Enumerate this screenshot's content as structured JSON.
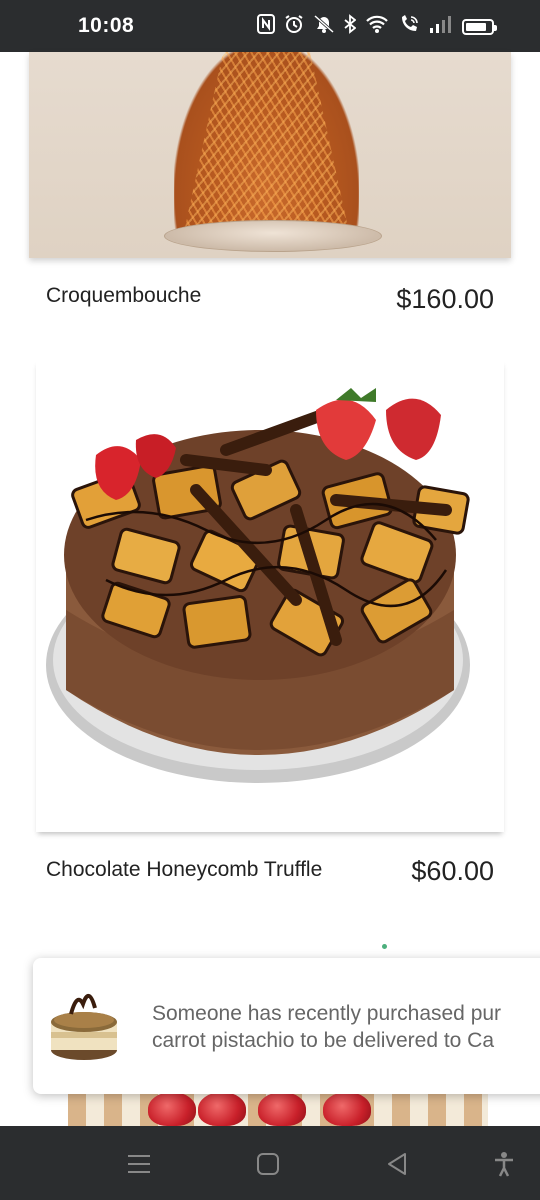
{
  "status_bar": {
    "time": "10:08",
    "icons": [
      "nfc-icon",
      "alarm-icon",
      "mute-icon",
      "bluetooth-icon",
      "wifi-icon",
      "wifi-calling-icon",
      "signal-icon",
      "battery-icon"
    ]
  },
  "products": [
    {
      "name": "Croquembouche",
      "price": "$160.00"
    },
    {
      "name": "Chocolate Honeycomb Truffle",
      "price": "$60.00"
    }
  ],
  "toast": {
    "line1": "Someone has recently purchased pur",
    "line2": "carrot pistachio to be delivered to Ca"
  },
  "nav_bar": {
    "buttons": [
      "menu-icon",
      "home-icon",
      "back-icon",
      "accessibility-icon"
    ]
  },
  "colors": {
    "status_bar_bg": "#2b2d2f",
    "accent_dot": "#4caf7d"
  }
}
